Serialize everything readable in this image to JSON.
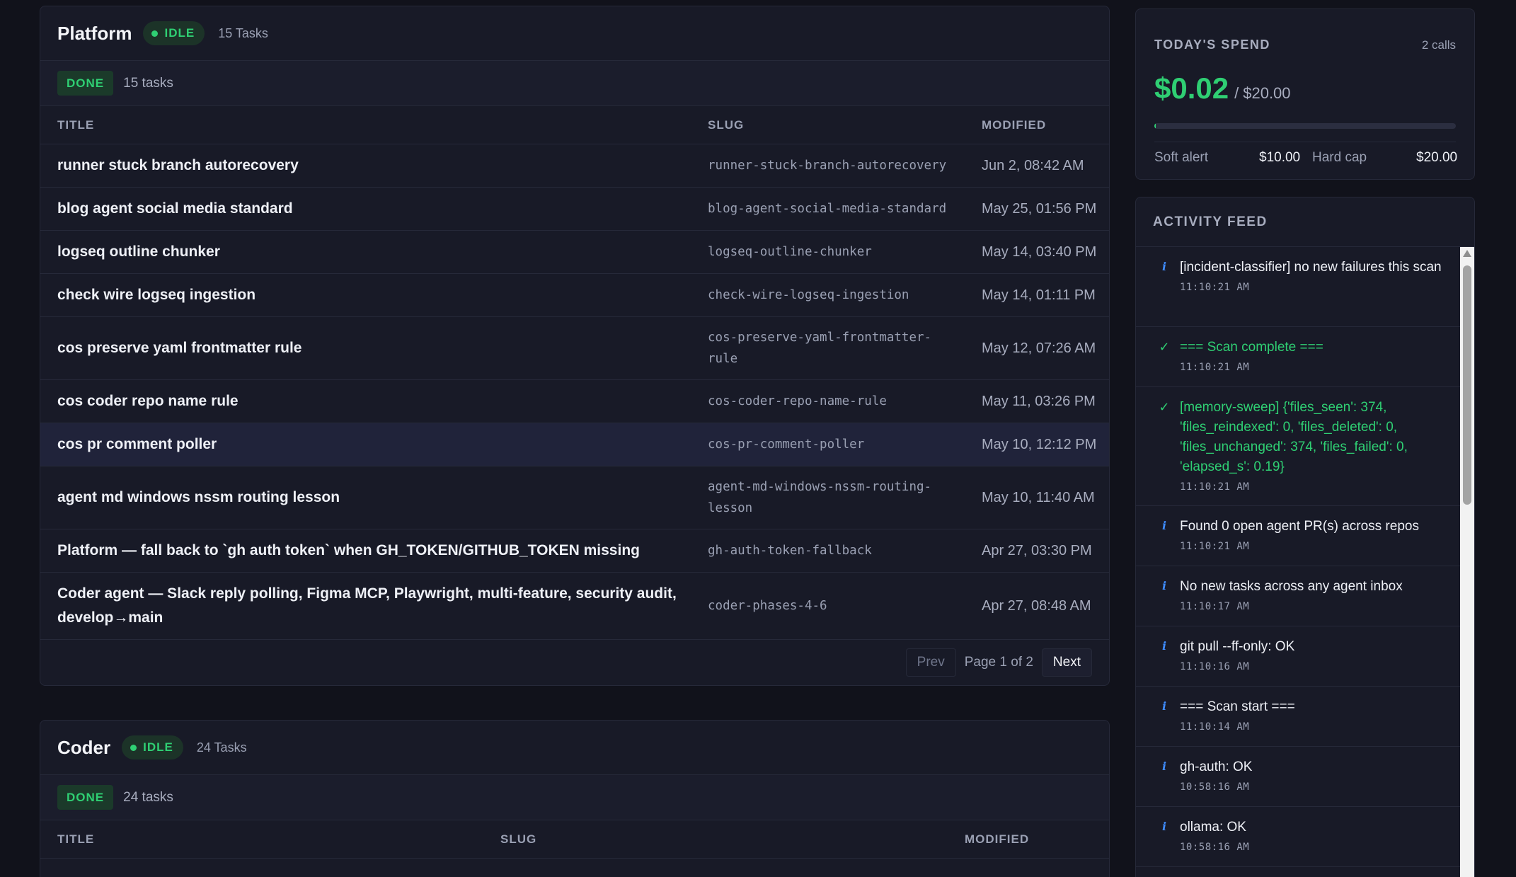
{
  "platform": {
    "name": "Platform",
    "status": "IDLE",
    "task_count": "15 Tasks",
    "group_status": "DONE",
    "group_count": "15 tasks",
    "columns": {
      "title": "TITLE",
      "slug": "SLUG",
      "modified": "MODIFIED"
    },
    "rows": [
      {
        "title": "runner stuck branch autorecovery",
        "slug": "runner-stuck-branch-autorecovery",
        "modified": "Jun 2, 08:42 AM"
      },
      {
        "title": "blog agent social media standard",
        "slug": "blog-agent-social-media-standard",
        "modified": "May 25, 01:56 PM"
      },
      {
        "title": "logseq outline chunker",
        "slug": "logseq-outline-chunker",
        "modified": "May 14, 03:40 PM"
      },
      {
        "title": "check wire logseq ingestion",
        "slug": "check-wire-logseq-ingestion",
        "modified": "May 14, 01:11 PM"
      },
      {
        "title": "cos preserve yaml frontmatter rule",
        "slug": "cos-preserve-yaml-frontmatter-rule",
        "modified": "May 12, 07:26 AM"
      },
      {
        "title": "cos coder repo name rule",
        "slug": "cos-coder-repo-name-rule",
        "modified": "May 11, 03:26 PM"
      },
      {
        "title": "cos pr comment poller",
        "slug": "cos-pr-comment-poller",
        "modified": "May 10, 12:12 PM"
      },
      {
        "title": "agent md windows nssm routing lesson",
        "slug": "agent-md-windows-nssm-routing-lesson",
        "modified": "May 10, 11:40 AM"
      },
      {
        "title": "Platform — fall back to `gh auth token` when GH_TOKEN/GITHUB_TOKEN missing",
        "slug": "gh-auth-token-fallback",
        "modified": "Apr 27, 03:30 PM"
      },
      {
        "title": "Coder agent — Slack reply polling, Figma MCP, Playwright, multi-feature, security audit, develop→main",
        "slug": "coder-phases-4-6",
        "modified": "Apr 27, 08:48 AM"
      }
    ],
    "pagination": {
      "prev": "Prev",
      "label": "Page 1 of 2",
      "next": "Next"
    }
  },
  "coder": {
    "name": "Coder",
    "status": "IDLE",
    "task_count": "24 Tasks",
    "group_status": "DONE",
    "group_count": "24 tasks",
    "columns": {
      "title": "TITLE",
      "slug": "SLUG",
      "modified": "MODIFIED"
    }
  },
  "spend": {
    "title": "TODAY'S SPEND",
    "calls": "2 calls",
    "current": "$0.02",
    "separator": "/",
    "limit": "$20.00",
    "progress_fraction": 0.001,
    "soft_label": "Soft alert",
    "soft_value": "$10.00",
    "hard_label": "Hard cap",
    "hard_value": "$20.00"
  },
  "feed": {
    "title": "ACTIVITY FEED",
    "items": [
      {
        "icon": "info-icon",
        "kind": "info",
        "message": "[incident-classifier] no new failures this scan",
        "time": "11:10:21 AM"
      },
      {
        "icon": "check-icon",
        "kind": "ok",
        "message": "=== Scan complete ===",
        "time": "11:10:21 AM"
      },
      {
        "icon": "check-icon",
        "kind": "ok",
        "message": "[memory-sweep] {'files_seen': 374, 'files_reindexed': 0, 'files_deleted': 0, 'files_unchanged': 374, 'files_failed': 0, 'elapsed_s': 0.19}",
        "time": "11:10:21 AM"
      },
      {
        "icon": "info-icon",
        "kind": "info",
        "message": "Found 0 open agent PR(s) across repos",
        "time": "11:10:21 AM"
      },
      {
        "icon": "info-icon",
        "kind": "info",
        "message": "No new tasks across any agent inbox",
        "time": "11:10:17 AM"
      },
      {
        "icon": "info-icon",
        "kind": "info",
        "message": "git pull --ff-only: OK",
        "time": "11:10:16 AM"
      },
      {
        "icon": "info-icon",
        "kind": "info",
        "message": "=== Scan start ===",
        "time": "11:10:14 AM"
      },
      {
        "icon": "info-icon",
        "kind": "info",
        "message": "gh-auth: OK",
        "time": "10:58:16 AM"
      },
      {
        "icon": "info-icon",
        "kind": "info",
        "message": "ollama: OK",
        "time": "10:58:16 AM"
      }
    ]
  },
  "colors": {
    "accent_green": "#2fcf73",
    "info_blue": "#3f8cff",
    "background": "#11121b",
    "card": "#181a27"
  }
}
